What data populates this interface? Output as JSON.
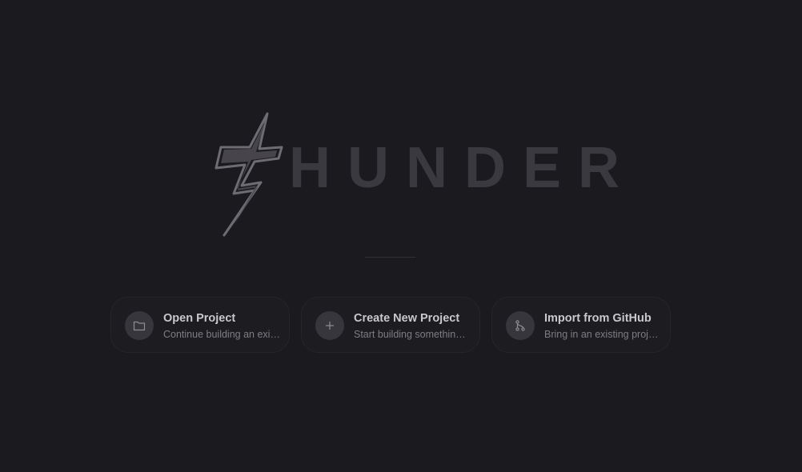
{
  "brand": {
    "wordmark": "HUNDER",
    "logo_letter": "T",
    "logo_color": "#6d6c72",
    "wordmark_color": "#3a393f"
  },
  "colors": {
    "background": "#1b1a1f",
    "card_background": "#1d1c21",
    "card_border": "#26252b",
    "icon_circle": "#37363c",
    "title_text": "#c9c8cc",
    "subtitle_text": "#7e7d83"
  },
  "actions": [
    {
      "icon": "folder-icon",
      "title": "Open Project",
      "subtitle": "Continue building an existing project"
    },
    {
      "icon": "plus-icon",
      "title": "Create New Project",
      "subtitle": "Start building something new"
    },
    {
      "icon": "git-branch-icon",
      "title": "Import from GitHub",
      "subtitle": "Bring in an existing project"
    }
  ]
}
